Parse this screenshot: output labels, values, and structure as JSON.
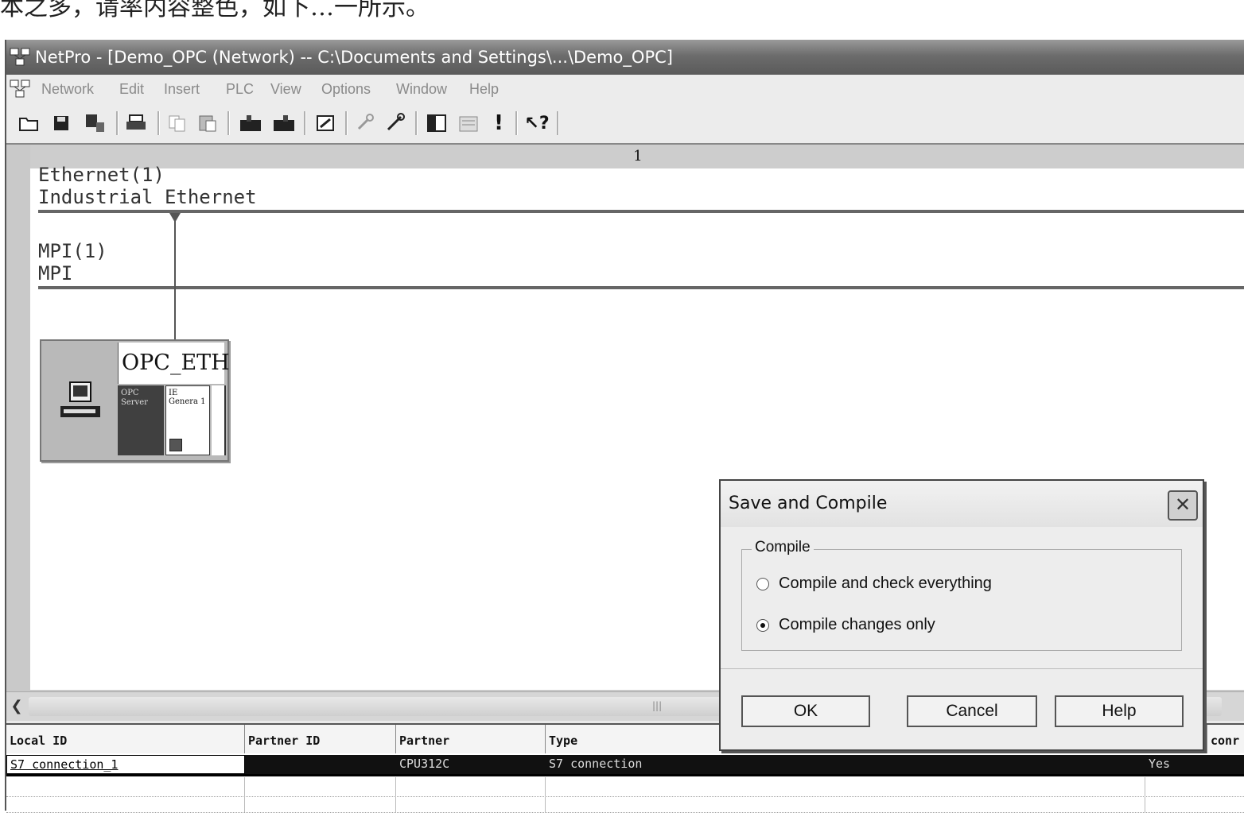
{
  "top_strip_text": "本之多，请率内容整色，如下…一所示。",
  "window": {
    "title": "NetPro - [Demo_OPC (Network) -- C:\\Documents and Settings\\...\\Demo_OPC]"
  },
  "menu": [
    "Network",
    "Edit",
    "Insert",
    "PLC",
    "View",
    "Options",
    "Window",
    "Help"
  ],
  "toolbar_icons": [
    "open-icon",
    "save-icon",
    "download-icon",
    "print-icon",
    "copy-icon",
    "paste-icon",
    "station-icon",
    "station2-icon",
    "config-icon",
    "tool-icon",
    "link-icon",
    "table-icon",
    "compile-icon",
    "exclaim-icon",
    "help-pointer-icon"
  ],
  "network": {
    "column_number": "1",
    "subnets": [
      {
        "name": "Ethernet(1)",
        "type": "Industrial Ethernet"
      },
      {
        "name": "MPI(1)",
        "type": "MPI"
      }
    ],
    "station": {
      "name": "OPC_ETH",
      "slot1": "OPC Server",
      "slot2": "IE Genera 1"
    }
  },
  "connection_table": {
    "headers": [
      "Local ID",
      "Partner ID",
      "Partner",
      "Type",
      "conr"
    ],
    "rows": [
      {
        "local_id": "S7 connection_1",
        "partner_id": "",
        "partner": "CPU312C",
        "type": "S7 connection",
        "active": "Yes"
      }
    ]
  },
  "dialog": {
    "title": "Save and Compile",
    "group_label": "Compile",
    "options": [
      {
        "label": "Compile and check everything",
        "selected": false
      },
      {
        "label": "Compile changes only",
        "selected": true
      }
    ],
    "buttons": {
      "ok": "OK",
      "cancel": "Cancel",
      "help": "Help"
    }
  }
}
